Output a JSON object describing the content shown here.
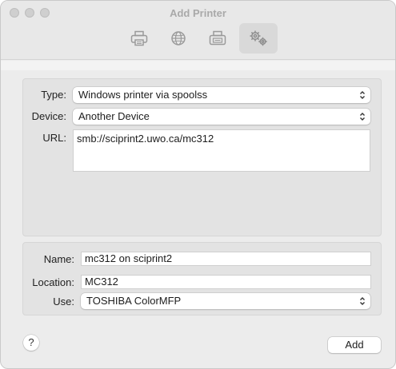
{
  "window": {
    "title": "Add Printer"
  },
  "toolbar": {
    "buttons": [
      {
        "icon": "printer-icon",
        "selected": false
      },
      {
        "icon": "globe-icon",
        "selected": false
      },
      {
        "icon": "fax-printer-icon",
        "selected": false
      },
      {
        "icon": "gears-icon",
        "selected": true
      }
    ]
  },
  "connection": {
    "type_label": "Type:",
    "type_value": "Windows printer via spoolss",
    "device_label": "Device:",
    "device_value": "Another Device",
    "url_label": "URL:",
    "url_value": "smb://sciprint2.uwo.ca/mc312"
  },
  "details": {
    "name_label": "Name:",
    "name_value": "mc312 on sciprint2",
    "location_label": "Location:",
    "location_value": "MC312",
    "use_label": "Use:",
    "use_value": "TOSHIBA ColorMFP"
  },
  "footer": {
    "help_label": "?",
    "add_label": "Add"
  },
  "colors": {
    "window_bg": "#ececec",
    "panel_bg": "#e3e3e3",
    "selected_tab_bg": "#d9d9d9",
    "icon_gray": "#9a9a9a"
  }
}
